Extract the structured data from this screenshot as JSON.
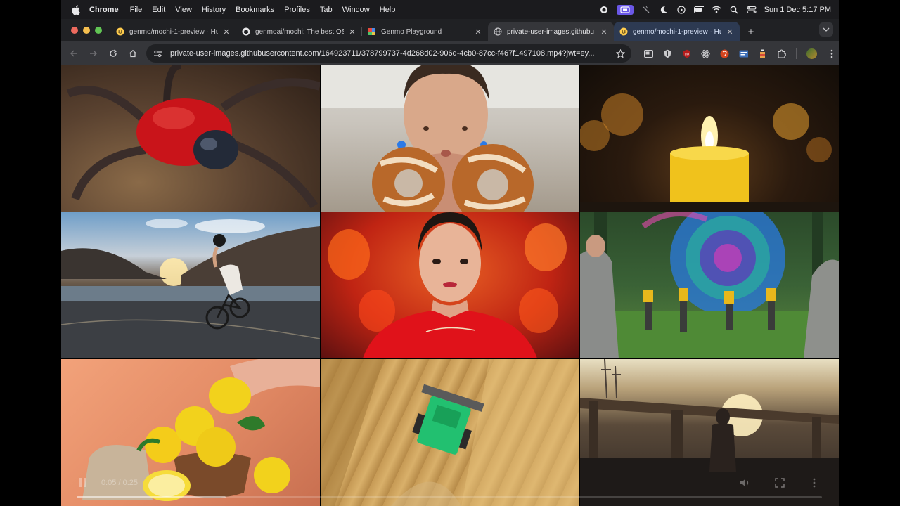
{
  "menubar": {
    "items": [
      "Chrome",
      "File",
      "Edit",
      "View",
      "History",
      "Bookmarks",
      "Profiles",
      "Tab",
      "Window",
      "Help"
    ],
    "clock": "Sun 1 Dec  5:17 PM"
  },
  "tabs": [
    {
      "title": "genmo/mochi-1-preview · Hu",
      "icon": "hugging-face-icon"
    },
    {
      "title": "genmoai/mochi: The best OS",
      "icon": "github-icon"
    },
    {
      "title": "Genmo Playground",
      "icon": "genmo-icon"
    },
    {
      "title": "private-user-images.githubu",
      "icon": "globe-icon"
    },
    {
      "title": "genmo/mochi-1-preview · Hu",
      "icon": "hugging-face-icon"
    }
  ],
  "toolbar": {
    "url": "private-user-images.githubusercontent.com/164923711/378799737-4d268d02-906d-4cb0-87cc-f467f1497108.mp4?jwt=ey..."
  },
  "video": {
    "time": "0:05 / 0:25",
    "progress": 0.2,
    "thumbnails": [
      "red-spider",
      "woman-with-donuts",
      "candle",
      "cyclist-by-lake",
      "woman-with-lanterns",
      "hikers-and-portal",
      "lemons",
      "combine-harvester",
      "bridge-at-sunset"
    ]
  },
  "colors": {
    "menubar": "#1b1b1e",
    "tabstrip": "#202124",
    "toolbar": "#35363a",
    "accent": "#6b58e8"
  }
}
